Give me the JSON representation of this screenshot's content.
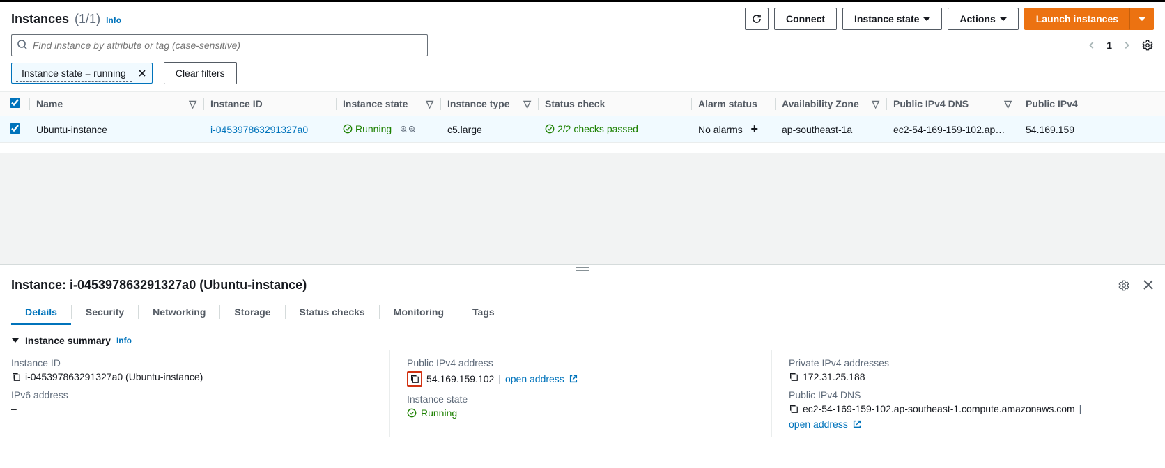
{
  "header": {
    "title": "Instances",
    "count": "(1/1)",
    "info": "Info"
  },
  "actions": {
    "connect": "Connect",
    "instance_state": "Instance state",
    "actions": "Actions",
    "launch": "Launch instances"
  },
  "search": {
    "placeholder": "Find instance by attribute or tag (case-sensitive)"
  },
  "pager": {
    "page": "1"
  },
  "chips": {
    "filter": "Instance state = running",
    "clear": "Clear filters"
  },
  "columns": {
    "name": "Name",
    "instance_id": "Instance ID",
    "instance_state": "Instance state",
    "instance_type": "Instance type",
    "status_check": "Status check",
    "alarm_status": "Alarm status",
    "az": "Availability Zone",
    "public_dns": "Public IPv4 DNS",
    "public_ip": "Public IPv4"
  },
  "row": {
    "name": "Ubuntu-instance",
    "instance_id": "i-045397863291327a0",
    "state": "Running",
    "type": "c5.large",
    "status": "2/2 checks passed",
    "alarm": "No alarms",
    "az": "ap-southeast-1a",
    "dns": "ec2-54-169-159-102.ap…",
    "ip": "54.169.159"
  },
  "detail": {
    "title": "Instance: i-045397863291327a0 (Ubuntu-instance)",
    "tabs": {
      "details": "Details",
      "security": "Security",
      "networking": "Networking",
      "storage": "Storage",
      "status": "Status checks",
      "monitoring": "Monitoring",
      "tags": "Tags"
    },
    "summary_heading": "Instance summary",
    "summary_info": "Info",
    "fields": {
      "instance_id_label": "Instance ID",
      "instance_id_value": "i-045397863291327a0 (Ubuntu-instance)",
      "public_ip_label": "Public IPv4 address",
      "public_ip_value": "54.169.159.102",
      "open_address": "open address",
      "private_ip_label": "Private IPv4 addresses",
      "private_ip_value": "172.31.25.188",
      "ipv6_label": "IPv6 address",
      "ipv6_value": "–",
      "state_label": "Instance state",
      "state_value": "Running",
      "dns_label": "Public IPv4 DNS",
      "dns_value": "ec2-54-169-159-102.ap-southeast-1.compute.amazonaws.com"
    }
  }
}
